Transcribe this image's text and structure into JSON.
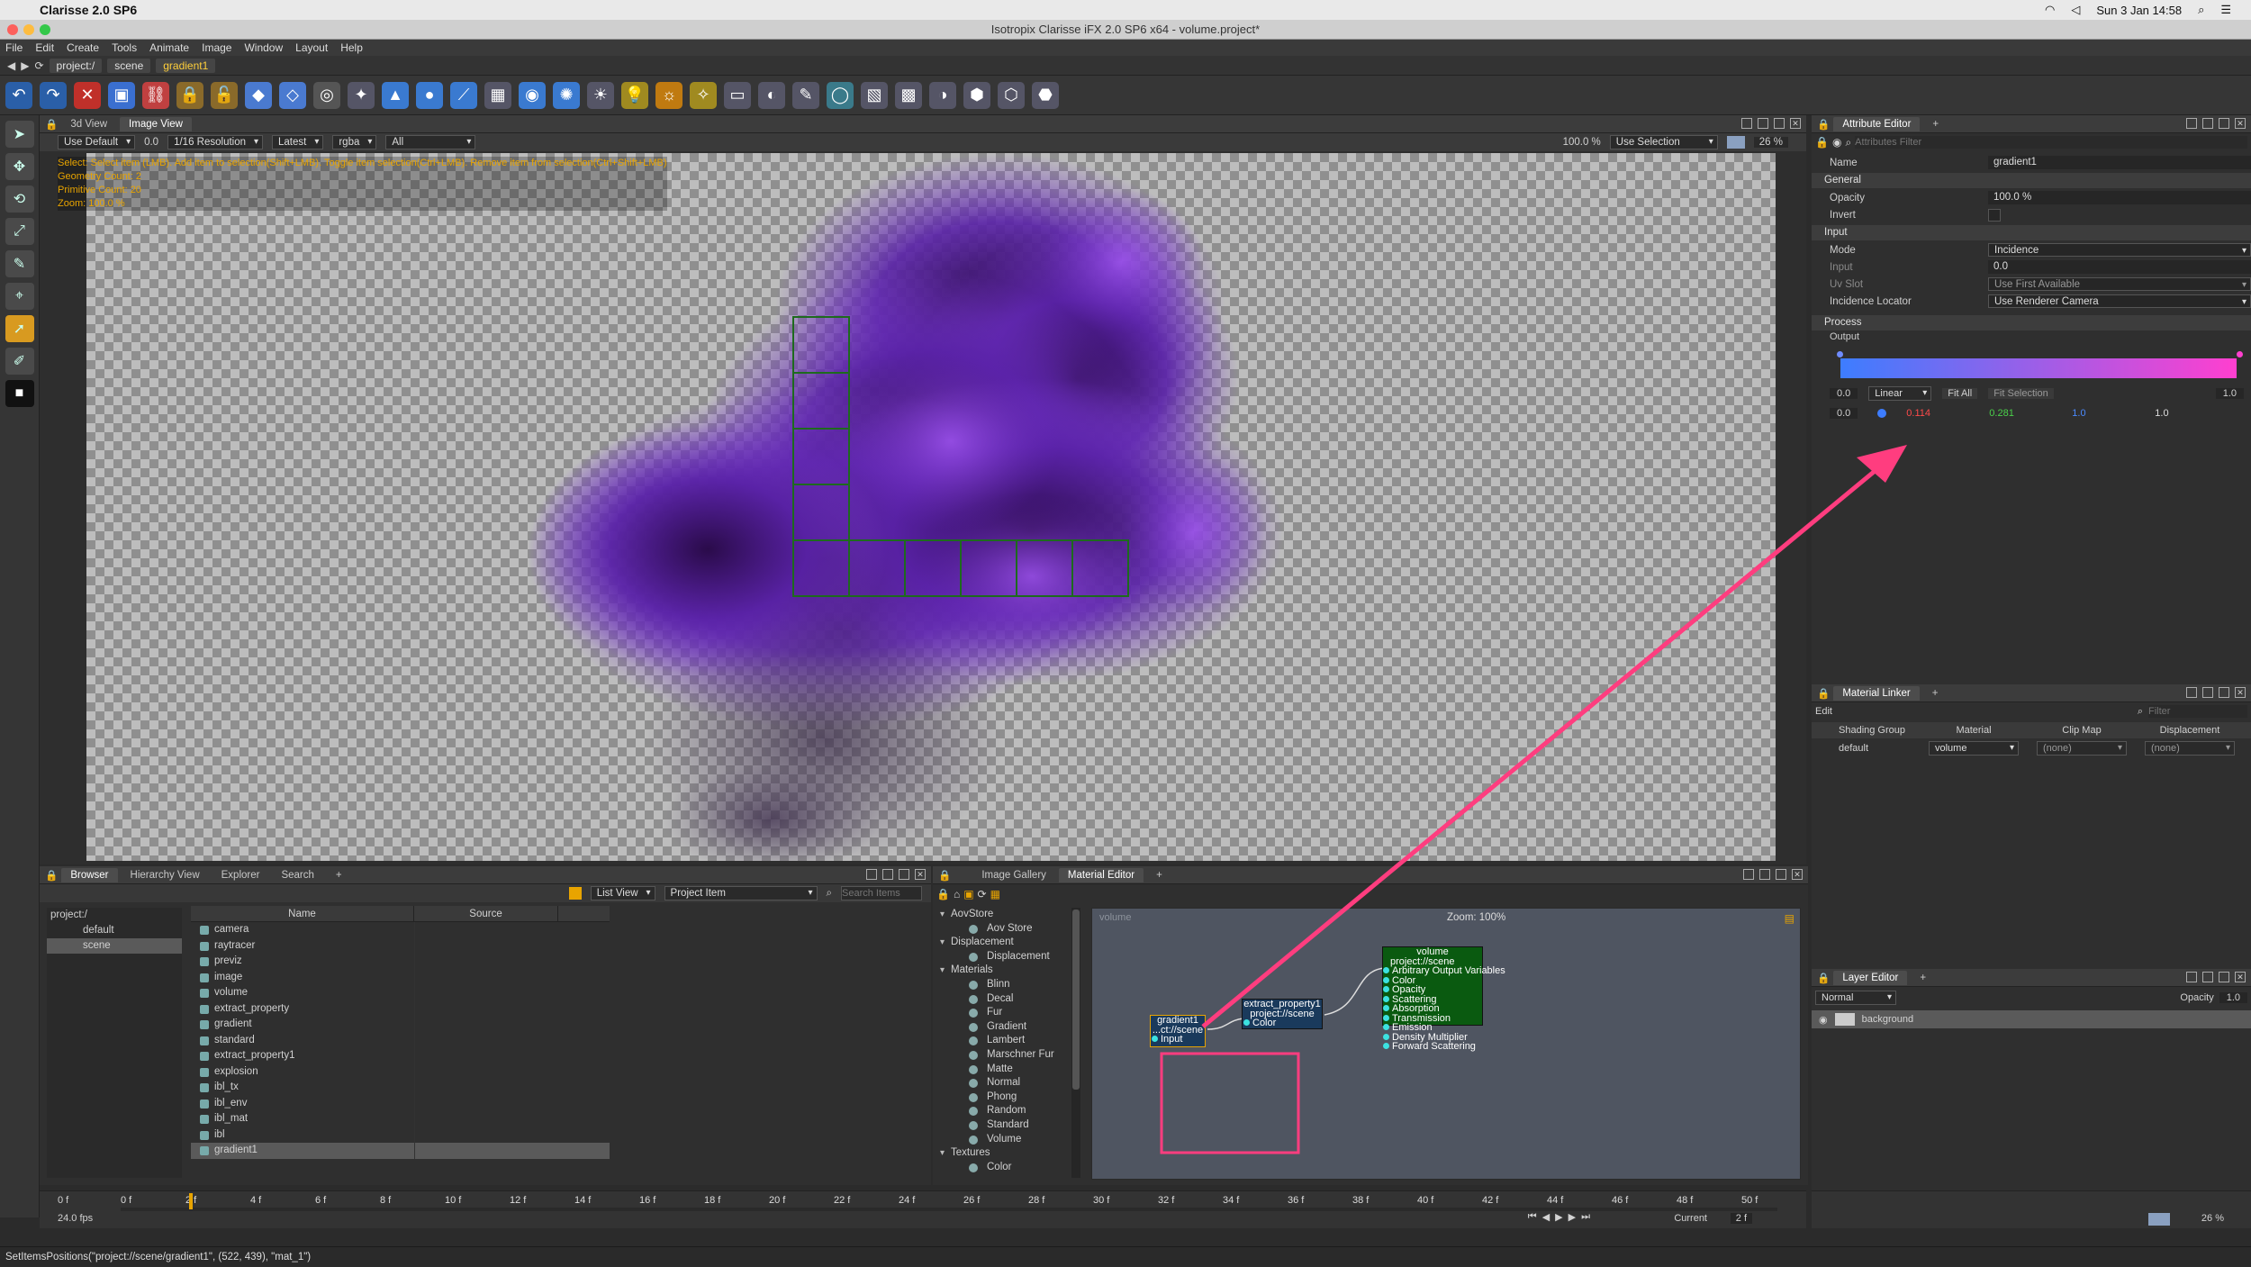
{
  "mac": {
    "app_name": "Clarisse 2.0 SP6",
    "clock": "Sun 3 Jan  14:58"
  },
  "window": {
    "title": "Isotropix Clarisse iFX 2.0 SP6 x64  - volume.project*"
  },
  "menu": [
    "File",
    "Edit",
    "Create",
    "Tools",
    "Animate",
    "Image",
    "Window",
    "Layout",
    "Help"
  ],
  "path": [
    "project:/",
    "scene",
    "gradient1"
  ],
  "viewport": {
    "tabs": [
      "3d View",
      "Image View"
    ],
    "active_tab": "Image View",
    "use_default": "Use Default",
    "value": "0.0",
    "resolution": "1/16 Resolution",
    "latest": "Latest",
    "channel": "rgba",
    "layer": "All",
    "zoom_pct": "100.0 %",
    "selection": "Use Selection",
    "percent": "26 %",
    "overlay_lines": [
      "Select: Select item (LMB). Add item to selection(Shift+LMB). Toggle item selection(Ctrl+LMB). Remove item from selection(Ctrl+Shift+LMB)",
      "Geometry Count: 2",
      "Primitive Count: 20",
      "Zoom: 100.0 %"
    ]
  },
  "browser": {
    "tabs": [
      "Browser",
      "Hierarchy View",
      "Explorer",
      "Search"
    ],
    "active_tab": "Browser",
    "list_view": "List View",
    "project_item": "Project Item",
    "search_placeholder": "Search Items",
    "tree": [
      "project:/",
      "default",
      "scene"
    ],
    "columns": [
      "Name",
      "Source"
    ],
    "items": [
      "camera",
      "raytracer",
      "previz",
      "image",
      "volume",
      "extract_property",
      "gradient",
      "standard",
      "extract_property1",
      "explosion",
      "ibl_tx",
      "ibl_env",
      "ibl_mat",
      "ibl",
      "gradient1"
    ],
    "selected": "gradient1"
  },
  "gallery": {
    "tabs": [
      "Image Gallery",
      "Material Editor"
    ],
    "active_tab": "Material Editor",
    "tree": [
      {
        "type": "cat",
        "label": "AovStore"
      },
      {
        "type": "item",
        "label": "Aov Store"
      },
      {
        "type": "cat",
        "label": "Displacement"
      },
      {
        "type": "item",
        "label": "Displacement"
      },
      {
        "type": "cat",
        "label": "Materials"
      },
      {
        "type": "item",
        "label": "Blinn"
      },
      {
        "type": "item",
        "label": "Decal"
      },
      {
        "type": "item",
        "label": "Fur"
      },
      {
        "type": "item",
        "label": "Gradient"
      },
      {
        "type": "item",
        "label": "Lambert"
      },
      {
        "type": "item",
        "label": "Marschner Fur"
      },
      {
        "type": "item",
        "label": "Matte"
      },
      {
        "type": "item",
        "label": "Normal"
      },
      {
        "type": "item",
        "label": "Phong"
      },
      {
        "type": "item",
        "label": "Random"
      },
      {
        "type": "item",
        "label": "Standard"
      },
      {
        "type": "item",
        "label": "Volume"
      },
      {
        "type": "cat",
        "label": "Textures"
      },
      {
        "type": "item",
        "label": "Color"
      }
    ],
    "graph_label": "volume",
    "zoom": "Zoom: 100%",
    "nodes": {
      "gradient": {
        "title": "gradient1",
        "path": "...ct://scene",
        "input": "Input"
      },
      "extract": {
        "title": "extract_property1",
        "path": "project://scene",
        "port": "Color"
      },
      "volume": {
        "title": "volume",
        "path": "project://scene",
        "ports": [
          "Arbitrary Output Variables",
          "Color",
          "Opacity",
          "Scattering",
          "Absorption",
          "Transmission",
          "Emission",
          "Density Multiplier",
          "Forward Scattering"
        ]
      }
    }
  },
  "attributes": {
    "tab": "Attribute Editor",
    "filter_placeholder": "Attributes Filter",
    "name_label": "Name",
    "name_value": "gradient1",
    "general": "General",
    "opacity_label": "Opacity",
    "opacity_value": "100.0 %",
    "invert_label": "Invert",
    "input_section": "Input",
    "mode_label": "Mode",
    "mode_value": "Incidence",
    "input_label": "Input",
    "input_value": "0.0",
    "uvslot_label": "Uv Slot",
    "uvslot_value": "Use First Available",
    "locator_label": "Incidence Locator",
    "locator_value": "Use Renderer Camera",
    "process": "Process",
    "output": "Output",
    "ramp_min": "0.0",
    "interp": "Linear",
    "fit_all": "Fit All",
    "fit_selection": "Fit Selection",
    "ramp_max": "1.0",
    "key_pos": "0.0",
    "key_r": "0.114",
    "key_g": "0.281",
    "key_b": "1.0",
    "key_a": "1.0"
  },
  "material_linker": {
    "tab": "Material Linker",
    "edit": "Edit",
    "filter_placeholder": "Filter",
    "columns": [
      "Shading Group",
      "Material",
      "Clip Map",
      "Displacement"
    ],
    "row": [
      "default",
      "volume",
      "(none)",
      "(none)"
    ]
  },
  "layer_editor": {
    "tab": "Layer Editor",
    "blend": "Normal",
    "opacity_label": "Opacity",
    "opacity_value": "1.0",
    "layer": "background"
  },
  "timeline": {
    "start": "0 f",
    "fps": "24.0 fps",
    "ticks": [
      "0 f",
      "2 f",
      "4 f",
      "6 f",
      "8 f",
      "10 f",
      "12 f",
      "14 f",
      "16 f",
      "18 f",
      "20 f",
      "22 f",
      "24 f",
      "26 f",
      "28 f",
      "30 f",
      "32 f",
      "34 f",
      "36 f",
      "38 f",
      "40 f",
      "42 f",
      "44 f",
      "46 f",
      "48 f",
      "50 f"
    ],
    "end": "50 f",
    "current_label": "Current",
    "current_value": "2 f",
    "right_percent": "26 %"
  },
  "status": "SetItemsPositions(\"project://scene/gradient1\", (522, 439), \"mat_1\")",
  "colors": {
    "volume_node": "#0a5a10",
    "extract_node": "#1a3a5c",
    "highlight": "#ff3d7f",
    "ramp_start": "#3d7dff",
    "ramp_end": "#ff3fcf"
  }
}
